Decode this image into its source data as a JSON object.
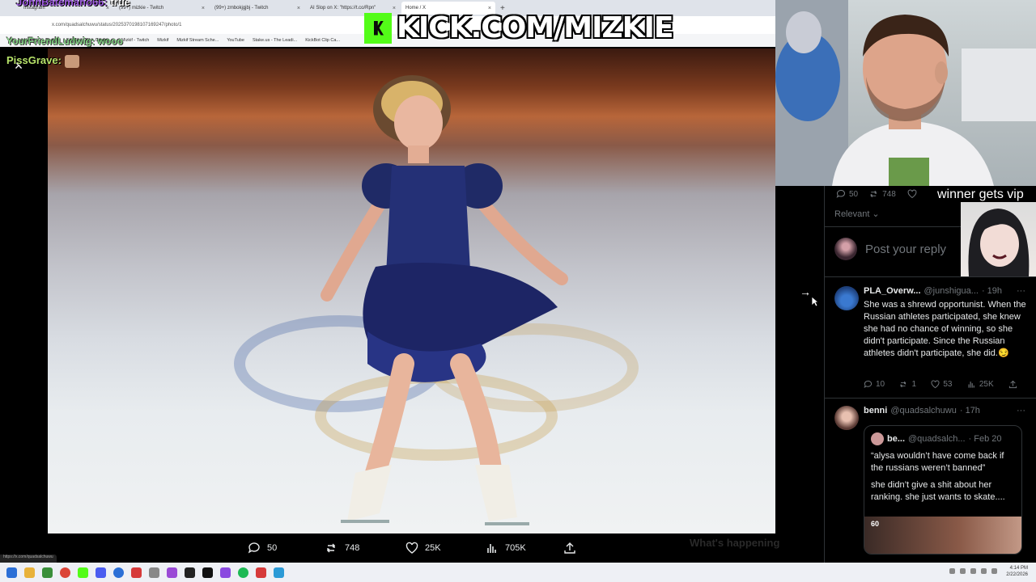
{
  "browser": {
    "tabs": [
      {
        "label": "Instagram",
        "active": false
      },
      {
        "label": "(99+) mizkie - Twitch",
        "active": false
      },
      {
        "label": "(99+) zmbokjgjbj - Twitch",
        "active": false
      },
      {
        "label": "AI Slop on X: \"https://t.co/Rpn\"",
        "active": false
      },
      {
        "label": "Home / X",
        "active": true
      }
    ],
    "new_tab": "+",
    "tab_close": "×",
    "url": "x.com/quadsalchuwu/status/2025370198107169247/photo/1",
    "bookmarks": [
      "Instagram",
      "Twitch",
      "KickBot - Kick Chatbo...",
      "Mizkif - Twitch",
      "Mizkif",
      "Mizkif Stream Sche...",
      "YouTube",
      "Stake.us - The Leadi...",
      "KickBot Clip Ca..."
    ],
    "status_url": "https://x.com/quadsalchuwu"
  },
  "overlay": {
    "chat": [
      {
        "user": "JohnBatemano66:",
        "message": "true"
      },
      {
        "user": "YourFriendLudwig:",
        "message": "wooo"
      },
      {
        "user": "PissGrave:",
        "message": ""
      }
    ],
    "kick_text": "KICK.COM/MIZKIE",
    "vip_text": "winner gets vip"
  },
  "viewer": {
    "close_icon": "×",
    "next_icon": "→",
    "actions": {
      "replies": "50",
      "reposts": "748",
      "likes": "25K",
      "views": "705K"
    },
    "ghost_bottom": "What's happening"
  },
  "pane": {
    "stats": {
      "replies": "50",
      "reposts": "748",
      "likes": ""
    },
    "sort_label": "Relevant",
    "reply_placeholder": "Post your reply",
    "tweets": [
      {
        "name": "PLA_Overw...",
        "handle": "@junshigua...",
        "time": "· 19h",
        "more": "···",
        "body": "She was a shrewd opportunist. When the Russian athletes participated, she knew she had no chance of winning, so she didn't participate. Since the Russian athletes didn't participate, she did.😏",
        "metrics": {
          "replies": "10",
          "reposts": "1",
          "likes": "53",
          "views": "25K"
        }
      },
      {
        "name": "benni",
        "handle": "@quadsalchuwu",
        "time": "· 17h",
        "more": "···",
        "quote": {
          "name": "be...",
          "handle": "@quadsalch...",
          "time": "· Feb 20",
          "body1": "“alysa wouldn’t have come back if the russians weren’t banned”",
          "body2": "she didn’t give a shit about her ranking. she just wants to skate....",
          "badge": "60"
        }
      }
    ]
  },
  "taskbar": {
    "time": "4:14 PM",
    "date": "2/22/2026"
  },
  "colors": {
    "x_background": "#000000",
    "x_text": "#e7e9ea",
    "x_muted": "#71767b",
    "kick_green": "#53fc18"
  }
}
